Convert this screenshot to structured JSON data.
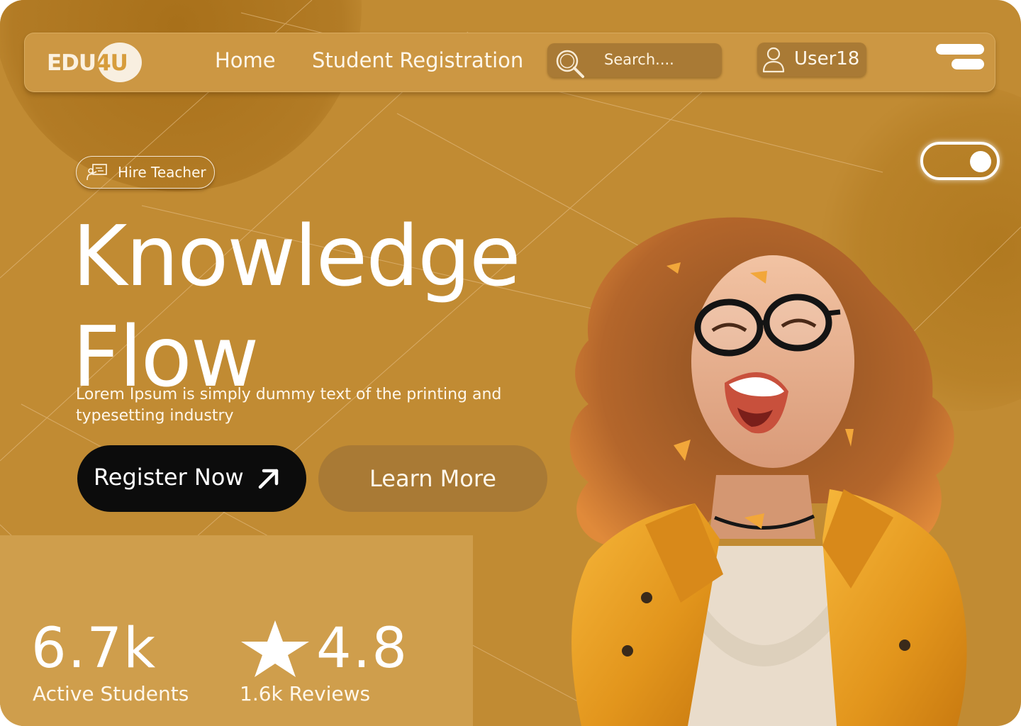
{
  "brand": {
    "logo_text_a": "EDU",
    "logo_text_b": "4U"
  },
  "nav": {
    "links": [
      {
        "label": "Home"
      },
      {
        "label": "Student Registration"
      }
    ],
    "search_placeholder": "Search....",
    "user_label": "User18",
    "search_icon": "search-icon",
    "user_icon": "user-icon",
    "menu_icon": "menu-icon"
  },
  "theme_toggle": {
    "state": "on"
  },
  "hero": {
    "badge_label": "Hire Teacher",
    "badge_icon": "teacher-board-icon",
    "title_line1": "Knowledge",
    "title_line2": "Flow",
    "description": "Lorem Ipsum is simply dummy text of the printing and typesetting industry",
    "primary_button": "Register Now",
    "primary_button_icon": "arrow-up-right-icon",
    "secondary_button": "Learn More"
  },
  "stats": [
    {
      "value": "6.7k",
      "label": "Active Students"
    },
    {
      "value": "4.8",
      "label": "1.6k Reviews",
      "icon": "star-icon"
    }
  ],
  "colors": {
    "background": "#c18b33",
    "navbar": "#cc9743",
    "pill_dark": "#a97a35",
    "primary_button": "#0c0c0c",
    "stats_panel": "#cf9e4c",
    "text": "#ffffff"
  }
}
